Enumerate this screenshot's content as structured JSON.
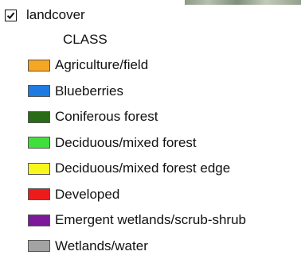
{
  "layer": {
    "name": "landcover",
    "checked": true,
    "field_header": "CLASS"
  },
  "legend": {
    "items": [
      {
        "label": "Agriculture/field",
        "color": "#f5a623"
      },
      {
        "label": "Blueberries",
        "color": "#1f7be0"
      },
      {
        "label": "Coniferous forest",
        "color": "#2a6b17"
      },
      {
        "label": "Deciduous/mixed forest",
        "color": "#3fe03c"
      },
      {
        "label": "Deciduous/mixed forest edge",
        "color": "#f7f71e"
      },
      {
        "label": "Developed",
        "color": "#ec1c1c"
      },
      {
        "label": "Emergent wetlands/scrub-shrub",
        "color": "#7d1a9b"
      },
      {
        "label": "Wetlands/water",
        "color": "#a3a3a3"
      }
    ]
  }
}
